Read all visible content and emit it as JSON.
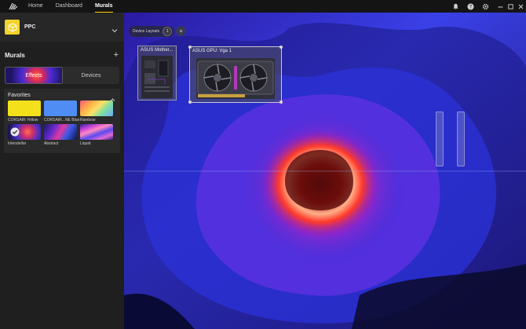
{
  "topbar": {
    "nav": [
      "Home",
      "Dashboard",
      "Murals"
    ],
    "active_nav": "Murals",
    "icons": [
      "bell-icon",
      "help-icon",
      "gear-icon"
    ],
    "window_controls": [
      "minimize",
      "restore",
      "close"
    ]
  },
  "profile": {
    "name": "PPC",
    "icon": "cube-icon"
  },
  "murals": {
    "title": "Murals",
    "tabs": [
      "Effects",
      "Devices"
    ],
    "active_tab": "Effects",
    "favorites": {
      "title": "Favorites",
      "items": [
        {
          "label": "CORSAIR Yellow",
          "color": "#f3e01b"
        },
        {
          "label": "CORSAIR...NE Blue",
          "color": "#4f8df5"
        },
        {
          "label": "Rainbow",
          "color": "gradient"
        },
        {
          "label": "Interstellar",
          "color": "image"
        },
        {
          "label": "Abstract",
          "color": "image"
        },
        {
          "label": "Liquid",
          "color": "image"
        }
      ]
    }
  },
  "canvas": {
    "device_layouts_label": "Device Layouts",
    "device_layouts_count": "1",
    "devices": [
      {
        "label": "ASUS Mother..."
      },
      {
        "label": "ASUS GPU: Vga 1"
      }
    ]
  },
  "colors": {
    "accent": "#ffd200",
    "sidebar_bg": "#1f1f1f",
    "mural_blue": "#2b31d6",
    "mural_red": "#ff3a2a"
  }
}
